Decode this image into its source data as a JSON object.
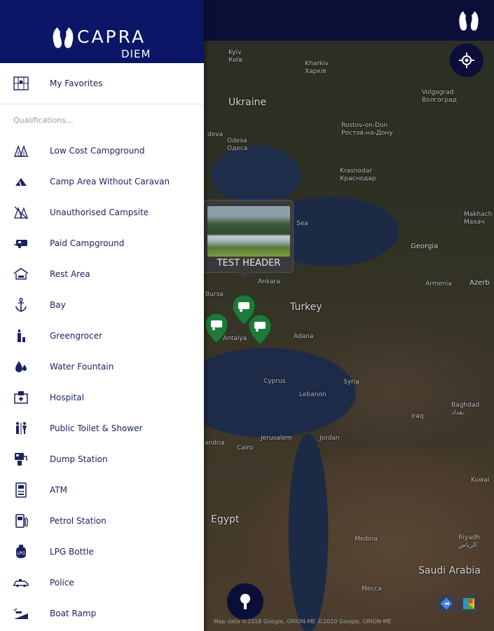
{
  "brand": {
    "name": "CAPRA",
    "sub": "DIEM"
  },
  "drawer": {
    "favorites_label": "My Favorites",
    "section_caption": "Qualifications...",
    "items": [
      {
        "label": "Low Cost Campground",
        "icon": "tents-icon"
      },
      {
        "label": "Camp Area Without Caravan",
        "icon": "tent-icon"
      },
      {
        "label": "Unauthorised Campsite",
        "icon": "forbidden-camp-icon"
      },
      {
        "label": "Paid Campground",
        "icon": "caravan-icon"
      },
      {
        "label": "Rest Area",
        "icon": "shelter-icon"
      },
      {
        "label": "Bay",
        "icon": "anchor-icon"
      },
      {
        "label": "Greengrocer",
        "icon": "bottle-icon"
      },
      {
        "label": "Water Fountain",
        "icon": "water-drops-icon"
      },
      {
        "label": "Hospital",
        "icon": "hospital-icon"
      },
      {
        "label": "Public Toilet & Shower",
        "icon": "toilet-icon"
      },
      {
        "label": "Dump Station",
        "icon": "dump-station-icon"
      },
      {
        "label": "ATM",
        "icon": "atm-icon"
      },
      {
        "label": "Petrol Station",
        "icon": "fuel-pump-icon"
      },
      {
        "label": "LPG Bottle",
        "icon": "gas-bottle-icon"
      },
      {
        "label": "Police",
        "icon": "police-car-icon"
      },
      {
        "label": "Boat Ramp",
        "icon": "boat-ramp-icon"
      }
    ]
  },
  "map": {
    "info_title": "TEST HEADER",
    "attribution": "Map data ©2018 Google, ORION-ME  ©2020 Google, ORION-ME",
    "labels": {
      "kyiv": "Kyiv\nКиїв",
      "kharkiv": "Kharkiv\nХарків",
      "ukraine": "Ukraine",
      "volgograd": "Volgograd\nВолгоград",
      "rostov": "Rostov-on-Don\nРостов-на-Дону",
      "odesa": "Odesa\nОдеса",
      "moldova": "deva",
      "krasnodar": "Krasnodar\nКраснодар",
      "makhach": "Makhach\nМахач",
      "georgia": "Georgia",
      "sea": "Sea",
      "armenia": "Armenia",
      "azerb": "Azerb",
      "ankara": "Ankara",
      "turkey": "Turkey",
      "bursa": "Bursa",
      "antalya": "Antalya",
      "adana": "Adana",
      "cyprus": "Cyprus",
      "syria": "Syria",
      "lebanon": "Lebanon",
      "iraq": "Iraq",
      "baghdad": "Baghdad\nبغداد",
      "jerusalem": "Jerusalem",
      "jordan": "Jordan",
      "cairo": "Cairo",
      "andria": "andria",
      "egypt": "Egypt",
      "kuwait": "Kuwai",
      "medina": "Medina",
      "riyadh": "Riyadh\nالرياض",
      "saudi": "Saudi Arabia",
      "mecca": "Mecca"
    }
  }
}
